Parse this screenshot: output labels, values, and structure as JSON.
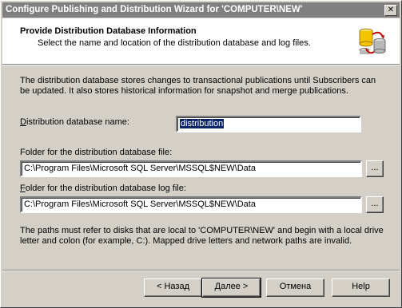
{
  "window": {
    "title": "Configure Publishing and Distribution Wizard for 'COMPUTER\\NEW'"
  },
  "header": {
    "title": "Provide Distribution Database Information",
    "subtitle": "Select the name and location of the distribution database and log files.",
    "icon": "database-wizard-icon"
  },
  "main": {
    "intro": "The distribution database stores changes to transactional publications until Subscribers can be updated. It also stores historical information for snapshot and merge publications.",
    "db_name": {
      "label_pre": "",
      "label_key": "D",
      "label_post": "istribution database name:",
      "value": "distribution"
    },
    "db_folder": {
      "label_pre": "Folder for the distribution database file:",
      "value": "C:\\Program Files\\Microsoft SQL Server\\MSSQL$NEW\\Data",
      "browse": "..."
    },
    "log_folder": {
      "label_key": "F",
      "label_post": "older for the distribution database log file:",
      "value": "C:\\Program Files\\Microsoft SQL Server\\MSSQL$NEW\\Data",
      "browse": "..."
    },
    "note": "The paths must refer to disks that are local to 'COMPUTER\\NEW' and begin with a local drive letter and colon (for example, C:). Mapped drive letters and network paths are invalid."
  },
  "footer": {
    "back": "< Назад",
    "next": "Далее >",
    "cancel": "Отмена",
    "help": "Help"
  }
}
